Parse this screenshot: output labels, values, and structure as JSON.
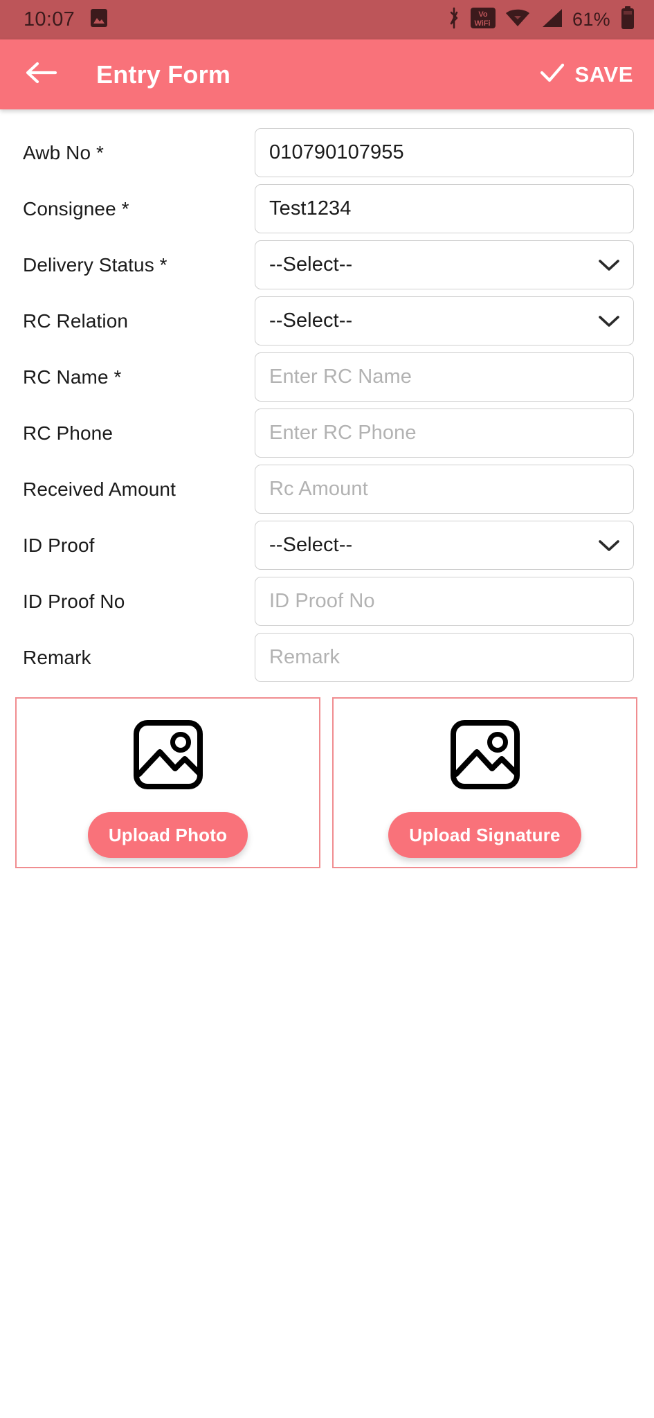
{
  "status_bar": {
    "time": "10:07",
    "battery_percent": "61%",
    "icons": [
      "image-icon",
      "bluetooth-icon",
      "vowifi-icon",
      "wifi-icon",
      "cellular-signal-icon",
      "battery-icon"
    ],
    "background_color": "#bd5559"
  },
  "app_bar": {
    "back_icon": "arrow-left-icon",
    "title": "Entry Form",
    "save_icon": "check-icon",
    "save_label": "SAVE",
    "background_color": "#f9727a"
  },
  "form": {
    "fields": [
      {
        "label": "Awb No *",
        "type": "text",
        "value": "010790107955",
        "placeholder": ""
      },
      {
        "label": "Consignee *",
        "type": "text",
        "value": "Test1234",
        "placeholder": ""
      },
      {
        "label": "Delivery Status *",
        "type": "select",
        "value": "--Select--",
        "placeholder": ""
      },
      {
        "label": "RC Relation",
        "type": "select",
        "value": "--Select--",
        "placeholder": ""
      },
      {
        "label": "RC Name *",
        "type": "text",
        "value": "",
        "placeholder": "Enter RC Name"
      },
      {
        "label": "RC Phone",
        "type": "text",
        "value": "",
        "placeholder": "Enter RC Phone"
      },
      {
        "label": "Received Amount",
        "type": "text",
        "value": "",
        "placeholder": "Rc Amount"
      },
      {
        "label": "ID Proof",
        "type": "select",
        "value": "--Select--",
        "placeholder": ""
      },
      {
        "label": "ID Proof No",
        "type": "text",
        "value": "",
        "placeholder": "ID Proof No"
      },
      {
        "label": "Remark",
        "type": "text",
        "value": "",
        "placeholder": "Remark"
      }
    ]
  },
  "uploads": [
    {
      "icon": "image-placeholder-icon",
      "button_label": "Upload Photo"
    },
    {
      "icon": "image-placeholder-icon",
      "button_label": "Upload Signature"
    }
  ],
  "colors": {
    "accent": "#f9727a",
    "status_bar": "#bd5559",
    "upload_border": "#f08d90",
    "field_border": "#cfcfcf",
    "placeholder_text": "#b2b2b2"
  }
}
